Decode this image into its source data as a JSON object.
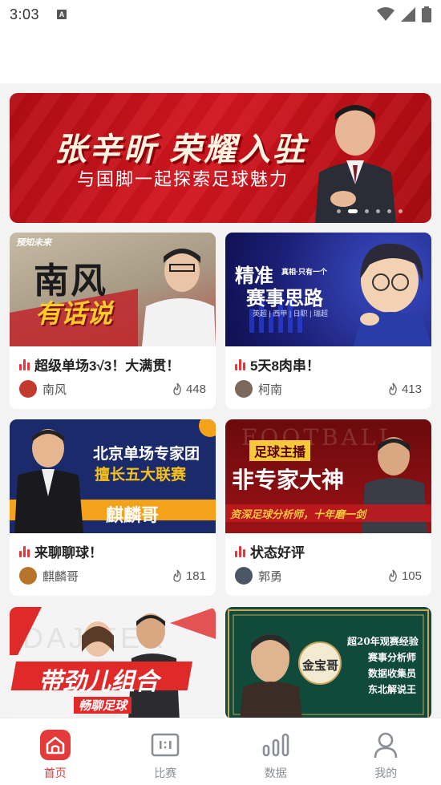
{
  "status_bar": {
    "time": "3:03",
    "notif": "A"
  },
  "banner": {
    "title": "张辛昕 荣耀入驻",
    "subtitle": "与国脚一起探索足球魅力",
    "dots": 6,
    "active_dot": 1
  },
  "cards": [
    {
      "image_tag": "预知未来",
      "image_line1": "南风",
      "image_line2": "有话说",
      "title": "超级单场3√3！大满贯！",
      "author": "南风",
      "likes": "448"
    },
    {
      "image_line1": "精准",
      "image_side": "赛事思路",
      "image_small": "真相·只有一个",
      "image_caption": "英超 | 西甲 | 日职 | 瑞超",
      "title": "5天8肉串！",
      "author": "柯南",
      "likes": "413"
    },
    {
      "image_line1": "北京单场专家团",
      "image_line2": "擅长五大联赛",
      "image_name": "麒麟哥",
      "title": "来聊聊球！",
      "author": "麒麟哥",
      "likes": "181"
    },
    {
      "image_bg_text": "FOOTBALL",
      "image_tag": "足球主播",
      "image_line1": "非专家大神",
      "image_line2": "资深足球分析师，十年磨一剑",
      "title": "状态好评",
      "author": "郭勇",
      "likes": "105"
    },
    {
      "image_bg_text": "DAJIEER",
      "image_line1": "带劲儿组合",
      "image_line2": "畅聊足球"
    },
    {
      "image_name": "金宝哥",
      "image_lines": [
        "超20年观赛经验",
        "赛事分析师",
        "数据收集员",
        "东北解说王"
      ]
    }
  ],
  "nav": [
    {
      "label": "首页",
      "icon": "home-icon",
      "active": true
    },
    {
      "label": "比赛",
      "icon": "scoreboard-icon",
      "active": false
    },
    {
      "label": "数据",
      "icon": "bar-chart-icon",
      "active": false
    },
    {
      "label": "我的",
      "icon": "user-icon",
      "active": false
    }
  ],
  "colors": {
    "accent": "#e43a3a",
    "banner_red": "#c8121b",
    "nav_gray": "#8a8f96"
  }
}
